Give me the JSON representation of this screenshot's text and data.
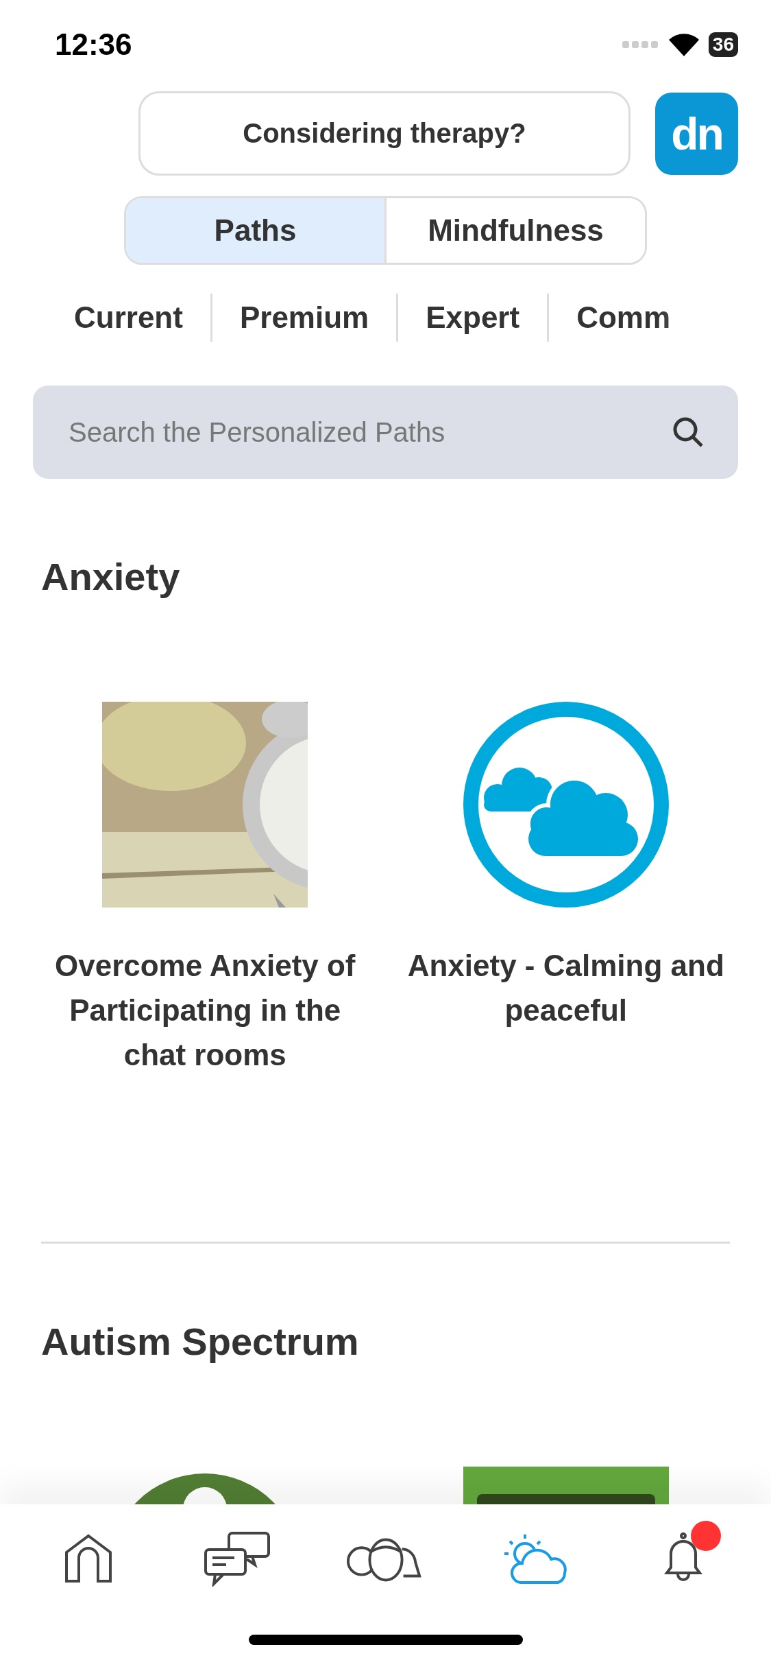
{
  "status_bar": {
    "time": "12:36",
    "battery": "36"
  },
  "header": {
    "cta": "Considering therapy?",
    "logo": "dn"
  },
  "segments": [
    {
      "label": "Paths",
      "selected": true
    },
    {
      "label": "Mindfulness",
      "selected": false
    }
  ],
  "filters": [
    {
      "label": "Current"
    },
    {
      "label": "Premium"
    },
    {
      "label": "Expert"
    },
    {
      "label": "Comm"
    }
  ],
  "search": {
    "placeholder": "Search the Personalized Paths"
  },
  "sections": [
    {
      "title": "Anxiety",
      "paths": [
        {
          "kind": "picture",
          "title": "Overcome Anxiety of Participating in the chat rooms"
        },
        {
          "kind": "cloud",
          "title": "Anxiety - Calming and peaceful"
        }
      ]
    },
    {
      "title": "Autism Spectrum",
      "paths": [
        {
          "kind": "keyhole"
        },
        {
          "kind": "picture"
        }
      ]
    }
  ],
  "tab_bar": [
    {
      "selected": false
    },
    {
      "selected": false
    },
    {
      "selected": false
    },
    {
      "selected": true
    },
    {
      "selected": false,
      "badge": true
    }
  ]
}
